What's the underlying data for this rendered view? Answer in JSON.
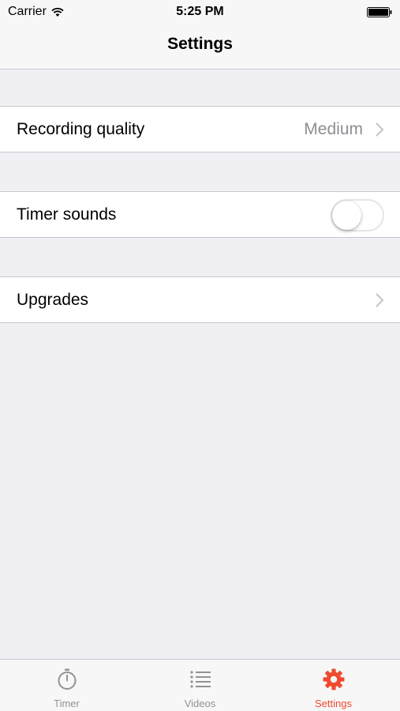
{
  "status_bar": {
    "carrier": "Carrier",
    "time": "5:25 PM"
  },
  "nav": {
    "title": "Settings"
  },
  "settings": {
    "recording_quality": {
      "label": "Recording quality",
      "value": "Medium"
    },
    "timer_sounds": {
      "label": "Timer sounds",
      "enabled": false
    },
    "upgrades": {
      "label": "Upgrades"
    }
  },
  "tabs": [
    {
      "label": "Timer",
      "icon": "stopwatch-icon",
      "active": false
    },
    {
      "label": "Videos",
      "icon": "list-icon",
      "active": false
    },
    {
      "label": "Settings",
      "icon": "gear-icon",
      "active": true
    }
  ],
  "colors": {
    "accent": "#f04a2f",
    "inactive_tab": "#929292",
    "background": "#efeff4",
    "detail_text": "#8e8e93"
  }
}
